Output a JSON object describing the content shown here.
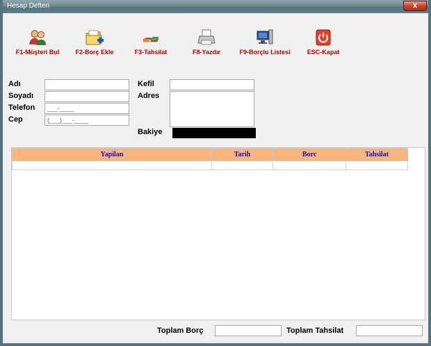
{
  "window": {
    "title": "Hesap Defteri",
    "close_label": "x",
    "background": "#f0f0f0"
  },
  "toolbar": [
    {
      "key": "musteri_bul",
      "label": "F1-Müşteri Bul",
      "icon": "users-icon"
    },
    {
      "key": "borc_ekle",
      "label": "F2-Borç Ekle",
      "icon": "folder-add-icon"
    },
    {
      "key": "tahsilat",
      "label": "F3-Tahsilat",
      "icon": "hand-money-icon"
    },
    {
      "key": "yazdir",
      "label": "F8-Yazdır",
      "icon": "printer-icon"
    },
    {
      "key": "borclu_listesi",
      "label": "F9-Borçlu Listesi",
      "icon": "computer-list-icon"
    },
    {
      "key": "kapat",
      "label": "ESC-Kapat",
      "icon": "power-icon"
    }
  ],
  "form": {
    "adi_label": "Adı",
    "soyadi_label": "Soyadı",
    "telefon_label": "Telefon",
    "telefon_value": "___-____",
    "cep_label": "Cep",
    "cep_value": "(___)___-____",
    "kefil_label": "Kefil",
    "adres_label": "Adres",
    "bakiye_label": "Bakiye"
  },
  "grid": {
    "columns": [
      "Yapilan",
      "Tarih",
      "Borc",
      "Tahsilat"
    ],
    "header_color": "#fbb47b",
    "header_text_color": "#15159a"
  },
  "footer": {
    "toplam_borc_label": "Toplam Borç",
    "toplam_tahsilat_label": "Toplam Tahsilat"
  },
  "colors": {
    "label_red": "#c00000",
    "bakiye_box": "#000000"
  }
}
